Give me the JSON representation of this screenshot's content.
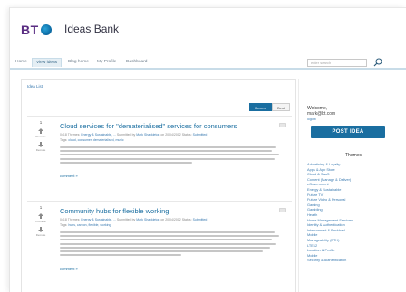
{
  "header": {
    "brand": "BT",
    "title": "Ideas Bank"
  },
  "nav": {
    "items": [
      {
        "label": "Home",
        "active": false
      },
      {
        "label": "View ideas",
        "active": true
      },
      {
        "label": "Blog home",
        "active": false
      },
      {
        "label": "My Profile",
        "active": false
      },
      {
        "label": "Dashboard",
        "active": false
      }
    ],
    "search_placeholder": "enter search"
  },
  "main": {
    "breadcrumb": "Idea List",
    "sort_tabs": [
      {
        "label": "Recent",
        "active": true
      },
      {
        "label": "Best",
        "active": false
      }
    ],
    "ideas": [
      {
        "votes": "1",
        "vote_label": "Promote",
        "demote_label": "Demote",
        "title": "Cloud services for \"dematerialised\" services for consumers",
        "meta_prefix": "0418",
        "meta_topics_label": "Themes:",
        "meta_topics": "Energy & Sustainable, ...",
        "meta_submitted": "Submitted by",
        "meta_author": "Mark Shackleton",
        "meta_date": "on 20/04/2012",
        "meta_status_label": "Status:",
        "meta_status": "Submitted",
        "tags_label": "Tags:",
        "tags": "cloud, consumer, dematerialised, music",
        "comment_label": "comment »"
      },
      {
        "votes": "1",
        "vote_label": "Promote",
        "demote_label": "Demote",
        "title": "Community hubs for flexible working",
        "meta_prefix": "0418",
        "meta_topics_label": "Themes:",
        "meta_topics": "Energy & Sustainable, ...",
        "meta_submitted": "Submitted by",
        "meta_author": "Mark Shackleton",
        "meta_date": "on 20/04/2012",
        "meta_status_label": "Status:",
        "meta_status": "Submitted",
        "tags_label": "Tags:",
        "tags": "hubs, carbon, flexible, working",
        "comment_label": "comment »"
      }
    ]
  },
  "sidebar": {
    "welcome": "Welcome,",
    "email": "mark@bt.com",
    "logout": "logout",
    "post_button": "POST IDEA",
    "themes_title": "Themes",
    "themes": [
      "Advertising & Loyalty",
      "Apps & App Store",
      "Cloud & SaaS",
      "Content (Manage & Deliver)",
      "eGovernment",
      "Energy & Sustainable",
      "Future TV",
      "Future Video & Personal",
      "Gaming",
      "Gambling",
      "Health",
      "Home Management Services",
      "Identity & Authentication",
      "Interconnect & Backhaul",
      "Mobile",
      "Manageability (ETH)",
      "LTE12",
      "Location & Profile",
      "Mobile",
      "Security & Authentication"
    ]
  },
  "colors": {
    "accent": "#1a6ea0",
    "brand_purple": "#5a2d82",
    "link": "#3a7ab0"
  }
}
